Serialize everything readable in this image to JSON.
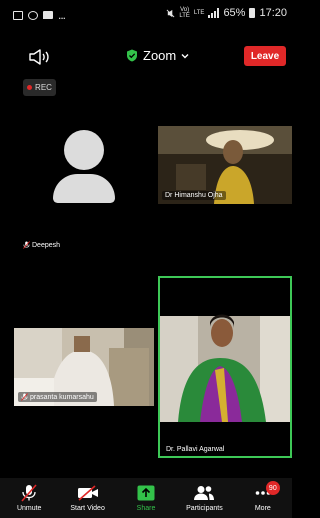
{
  "status_bar": {
    "network_tiny_1": "Vo)",
    "network_tiny_2": "LTE",
    "battery": "65%",
    "time": "17:20",
    "ellipsis": "..."
  },
  "meeting": {
    "title": "Zoom",
    "leave_label": "Leave",
    "rec_label": "REC"
  },
  "participants": [
    {
      "name": "Deepesh",
      "muted": true
    },
    {
      "name": "Dr Himanshu Ojha",
      "muted": false
    },
    {
      "name": "prasanta kumarsahu",
      "muted": true
    },
    {
      "name": "Dr. Pallavi Agarwal",
      "muted": false,
      "active_speaker": true
    }
  ],
  "toolbar": {
    "unmute": "Unmute",
    "start_video": "Start Video",
    "share": "Share",
    "participants": "Participants",
    "more": "More",
    "more_badge": "90"
  },
  "colors": {
    "leave": "#e02828",
    "share": "#33c24a",
    "active_border": "#3ec857"
  }
}
